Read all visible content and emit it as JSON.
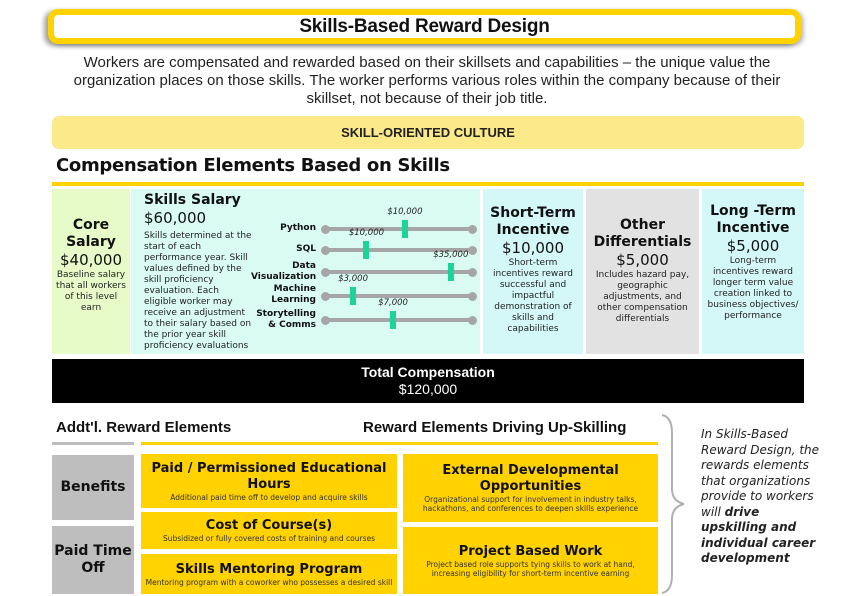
{
  "title": "Skills-Based Reward Design",
  "intro": "Workers are compensated and rewarded based on their skillsets and capabilities – the unique value the organization places on those skills. The worker performs various roles within the company because of their skillset, not because of their job title.",
  "culture_banner": "SKILL-ORIENTED CULTURE",
  "compensation": {
    "heading": "Compensation Elements Based on Skills",
    "core": {
      "title": "Core Salary",
      "amount": "$40,000",
      "description": "Baseline salary that all workers of this level earn"
    },
    "skills_salary": {
      "title": "Skills Salary",
      "amount": "$60,000",
      "description": "Skills determined at the start of each performance year. Skill values defined by the skill proficiency evaluation. Each eligible worker may receive an adjustment to their salary based on the prior year skill proficiency evaluations",
      "sliders": [
        {
          "label": "Python",
          "value_label": "$10,000",
          "level": 0.54
        },
        {
          "label": "SQL",
          "value_label": "$10,000",
          "level": 0.28
        },
        {
          "label": "Data Visualization",
          "value_label": "$35,000",
          "level": 0.85
        },
        {
          "label": "Machine Learning",
          "value_label": "$3,000",
          "level": 0.19
        },
        {
          "label": "Storytelling & Comms",
          "value_label": "$7,000",
          "level": 0.46
        }
      ]
    },
    "short_term": {
      "title": "Short-Term Incentive",
      "amount": "$10,000",
      "description": "Short-term incentives reward successful and impactful demonstration of skills and capabilities"
    },
    "other": {
      "title": "Other Differentials",
      "amount": "$5,000",
      "description": "Includes hazard pay, geographic adjustments, and other compensation differentials"
    },
    "long_term": {
      "title": "Long -Term Incentive",
      "amount": "$5,000",
      "description": "Long-term incentives reward longer term value creation linked to business objectives/ performance"
    },
    "total": {
      "label": "Total Compensation",
      "amount": "$120,000"
    }
  },
  "additional": {
    "heading": "Addt'l. Reward Elements",
    "upskilling_heading": "Reward Elements Driving Up-Skilling",
    "categories": [
      "Benefits",
      "Paid Time Off"
    ],
    "items": [
      {
        "title": "Paid / Permissioned Educational Hours",
        "description": "Additional paid time off to develop and acquire skills"
      },
      {
        "title": "Cost of Course(s)",
        "description": "Subsidized or fully covered costs of training and courses"
      },
      {
        "title": "Skills Mentoring Program",
        "description": "Mentoring program with a coworker who possesses a desired skill"
      },
      {
        "title": "External Developmental Opportunities",
        "description": "Organizational support for involvement in industry talks, hackathons, and conferences to deepen skills experience"
      },
      {
        "title": "Project Based Work",
        "description": "Project based role supports tying skills to work at hand, increasing eligibility for short-term incentive earning"
      }
    ]
  },
  "side_note": {
    "plain": "In Skills-Based Reward Design, the rewards elements that organizations provide to workers will ",
    "bold": "drive upskilling and individual career development"
  },
  "colors": {
    "accent_yellow": "#FFD200",
    "culture_banner": "#FCE98A",
    "slider_thumb": "#1ED39A",
    "core_bg": "#E6FBC8",
    "skills_bg": "#D9FBF1",
    "incentive_bg": "#D4F8F8",
    "other_bg": "#E2E2E2",
    "category_gray": "#BEBEBE"
  }
}
